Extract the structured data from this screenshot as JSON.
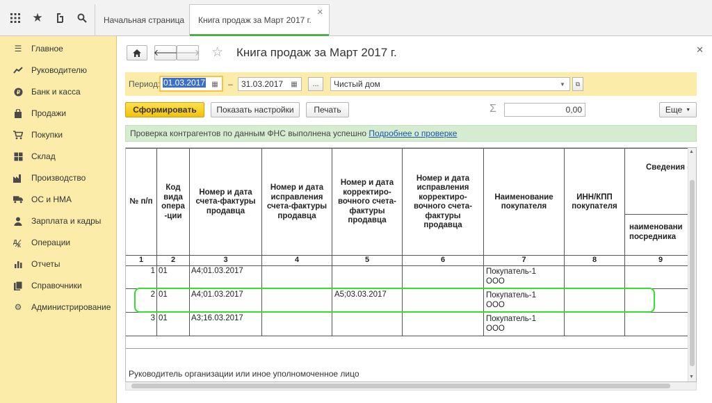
{
  "tabs": [
    {
      "label": "Начальная страница"
    },
    {
      "label": "Книга продаж за Март 2017 г."
    }
  ],
  "sidebar": {
    "items": [
      {
        "label": "Главное",
        "icon": "menu-lines-icon"
      },
      {
        "label": "Руководителю",
        "icon": "trend-icon"
      },
      {
        "label": "Банк и касса",
        "icon": "coin-icon"
      },
      {
        "label": "Продажи",
        "icon": "bag-icon"
      },
      {
        "label": "Покупки",
        "icon": "cart-icon"
      },
      {
        "label": "Склад",
        "icon": "warehouse-icon"
      },
      {
        "label": "Производство",
        "icon": "factory-icon"
      },
      {
        "label": "ОС и НМА",
        "icon": "truck-icon"
      },
      {
        "label": "Зарплата и кадры",
        "icon": "person-icon"
      },
      {
        "label": "Операции",
        "icon": "operations-icon"
      },
      {
        "label": "Отчеты",
        "icon": "bar-chart-icon"
      },
      {
        "label": "Справочники",
        "icon": "books-icon"
      },
      {
        "label": "Администрирование",
        "icon": "gear-icon"
      }
    ]
  },
  "header": {
    "title": "Книга продаж за Март 2017 г."
  },
  "filters": {
    "period_label": "Период:",
    "date_from": "01.03.2017",
    "dash": "–",
    "date_to": "31.03.2017",
    "ellipsis": "...",
    "organization": "Чистый дом"
  },
  "toolbar": {
    "generate": "Сформировать",
    "settings": "Показать настройки",
    "print": "Печать",
    "sum_symbol": "Σ",
    "sum_value": "0,00",
    "more": "Еще"
  },
  "info": {
    "text": "Проверка контрагентов по данным ФНС выполнена успешно",
    "link": "Подробнее о проверке"
  },
  "report": {
    "headers": [
      "№ п/п",
      "Код вида опера -ции",
      "Номер и дата счета-фактуры продавца",
      "Номер и дата исправления счета-фактуры продавца",
      "Номер и дата корректиро- вочного счета-фактуры продавца",
      "Номер и дата исправления корректиро- вочного счета-фактуры продавца",
      "Наименование покупателя",
      "ИНН/КПП покупателя",
      "Сведения (комисси",
      "наименовани посредника"
    ],
    "col_numbers": [
      "1",
      "2",
      "3",
      "4",
      "5",
      "6",
      "7",
      "8",
      "9"
    ],
    "rows": [
      {
        "n": "1",
        "code": "01",
        "invoice": "А4;01.03.2017",
        "fix": "",
        "corr": "",
        "corr_fix": "",
        "buyer1": "Покупатель-1",
        "buyer2": "ООО"
      },
      {
        "n": "2",
        "code": "01",
        "invoice": "А4;01.03.2017",
        "fix": "",
        "corr": "А5;03.03.2017",
        "corr_fix": "",
        "buyer1": "Покупатель-1",
        "buyer2": "ООО"
      },
      {
        "n": "3",
        "code": "01",
        "invoice": "А3;16.03.2017",
        "fix": "",
        "corr": "",
        "corr_fix": "",
        "buyer1": "Покупатель-1",
        "buyer2": "ООО"
      }
    ],
    "footer": "Руководитель организации или иное уполномоченное лицо"
  }
}
